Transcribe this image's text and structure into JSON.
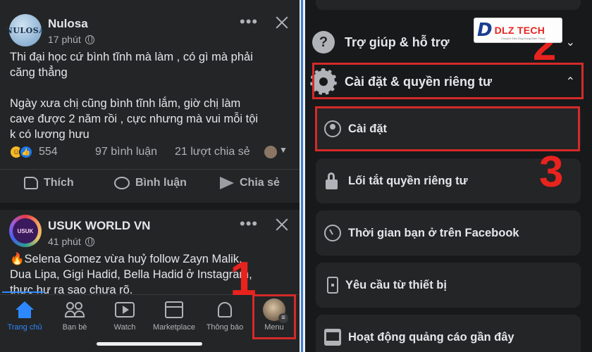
{
  "feed": {
    "posts": [
      {
        "author": "Nulosa",
        "avatar_text": "NULOSA",
        "time": "17 phút",
        "more": "•••",
        "text_lines": [
          "Thi đại học cứ bình tĩnh mà làm , có gì mà phải",
          "căng thẳng",
          "",
          "Ngày xưa chị cũng bình tĩnh lắm, giờ chị làm",
          "cave được 2 năm rồi , cực nhưng mà vui mỗi tội",
          "k có lương hưu"
        ],
        "reactions": "554",
        "comments": "97 bình luận",
        "shares": "21 lượt chia sẻ",
        "actions": {
          "like": "Thích",
          "comment": "Bình luận",
          "share": "Chia sẻ"
        }
      },
      {
        "author": "USUK WORLD VN",
        "time": "41 phút",
        "more": "•••",
        "text_lines": [
          "🔥Selena Gomez vừa huỷ follow Zayn Malik,",
          "Dua Lipa, Gigi Hadid, Bella Hadid ở Instagram,",
          "thực hư ra sao chưa rõ."
        ]
      }
    ]
  },
  "bottom_nav": {
    "tabs": [
      {
        "label": "Trang chủ",
        "icon": "home-icon",
        "active": true
      },
      {
        "label": "Bạn bè",
        "icon": "friends-icon"
      },
      {
        "label": "Watch",
        "icon": "watch-icon"
      },
      {
        "label": "Marketplace",
        "icon": "marketplace-icon"
      },
      {
        "label": "Thông báo",
        "icon": "bell-icon"
      },
      {
        "label": "Menu",
        "icon": "menu-avatar-icon"
      }
    ]
  },
  "menu_panel": {
    "help": {
      "label": "Trợ giúp & hỗ trợ",
      "icon": "question-icon",
      "chevron": "⌄"
    },
    "settings_privacy": {
      "label": "Cài đặt & quyền riêng tư",
      "icon": "gear-icon",
      "chevron": "⌃"
    },
    "items": [
      {
        "label": "Cài đặt",
        "icon": "user-circle-icon"
      },
      {
        "label": "Lối tắt quyền riêng tư",
        "icon": "lock-icon"
      },
      {
        "label": "Thời gian bạn ở trên Facebook",
        "icon": "clock-icon"
      },
      {
        "label": "Yêu cầu từ thiết bị",
        "icon": "phone-icon"
      },
      {
        "label": "Hoạt động quảng cáo gần đây",
        "icon": "ad-activity-icon"
      }
    ]
  },
  "annotations": {
    "step1": "1",
    "step2": "2",
    "step3": "3",
    "color": "#e8231e"
  },
  "watermark": {
    "brand": "DLZ TECH",
    "mark": "D",
    "slogan": "Chuyên Sửa Ứng Dụng Điện Thoại"
  }
}
